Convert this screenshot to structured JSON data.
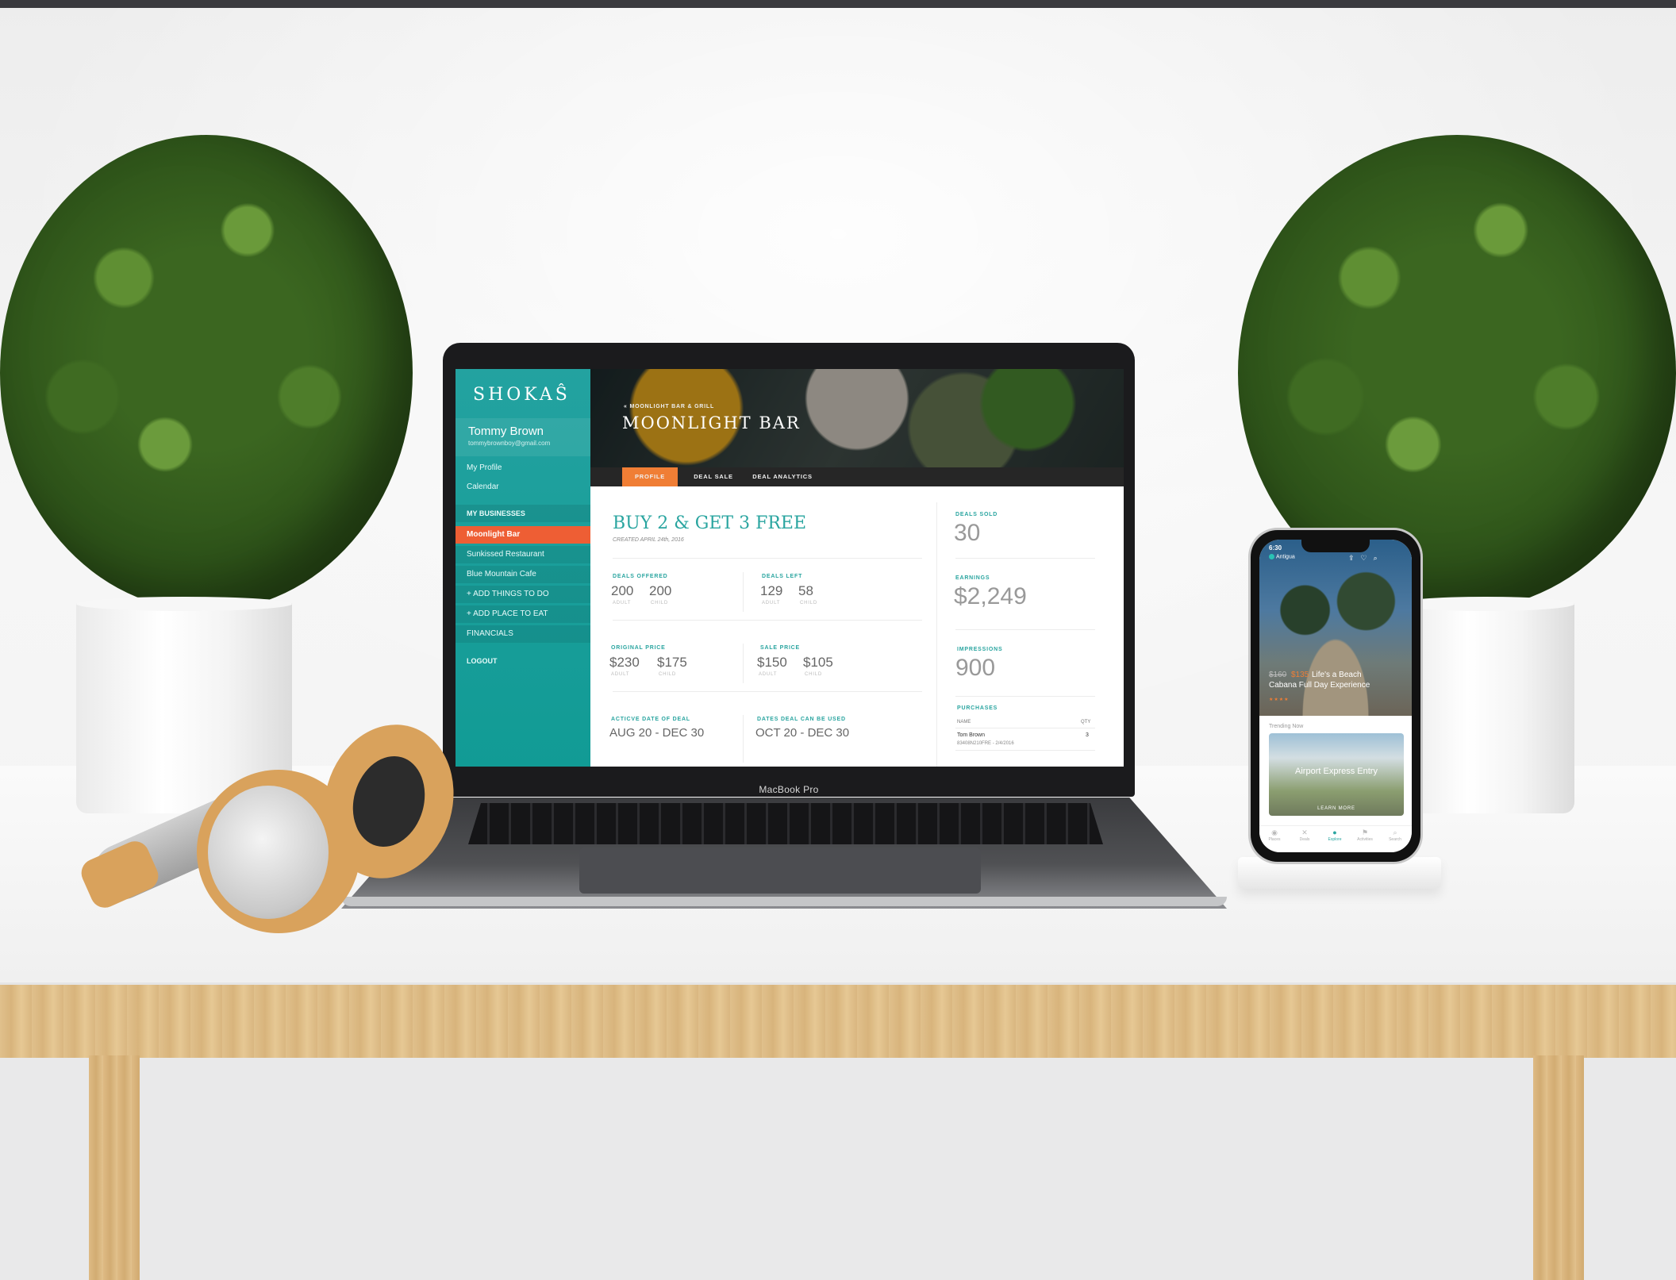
{
  "app": {
    "logo": "SHOKAŜ",
    "user": {
      "name": "Tommy Brown",
      "email": "tommybrownboy@gmail.com"
    },
    "nav": {
      "my_profile": "My Profile",
      "calendar": "Calendar",
      "my_businesses": "MY BUSINESSES",
      "businesses": [
        "Moonlight Bar",
        "Sunkissed Restaurant",
        "Blue Mountain Cafe"
      ],
      "add_things": "+ ADD THINGS TO DO",
      "add_place": "+ ADD PLACE TO EAT",
      "financials": "FINANCIALS",
      "logout": "LOGOUT"
    },
    "hero": {
      "breadcrumb": "« MOONLIGHT BAR & GRILL",
      "title": "MOONLIGHT BAR"
    },
    "tabs": [
      "PROFILE",
      "DEAL SALE",
      "DEAL ANALYTICS"
    ],
    "deal": {
      "title": "BUY 2 & GET 3 FREE",
      "created": "CREATED APRIL 24th, 2016",
      "deals_offered": {
        "label": "DEALS OFFERED",
        "adult": "200",
        "child": "200"
      },
      "deals_left": {
        "label": "DEALS LEFT",
        "adult": "129",
        "child": "58"
      },
      "original_price": {
        "label": "ORIGINAL PRICE",
        "adult": "$230",
        "child": "$175"
      },
      "sale_price": {
        "label": "SALE PRICE",
        "adult": "$150",
        "child": "$105"
      },
      "active_date": {
        "label": "ACTICVE DATE OF DEAL",
        "value": "AUG 20 - DEC 30"
      },
      "dates_used": {
        "label": "DATES DEAL CAN BE USED",
        "value": "OCT 20 - DEC 30"
      },
      "adult_label": "ADULT",
      "child_label": "CHILD"
    },
    "stats": {
      "deals_sold": {
        "label": "DEALS SOLD",
        "value": "30"
      },
      "earnings": {
        "label": "EARNINGS",
        "value": "$2,249"
      },
      "impressions": {
        "label": "IMPRESSIONS",
        "value": "900"
      },
      "purchases": {
        "label": "PURCHASES",
        "col_name": "NAME",
        "col_qty": "QTY",
        "rows": [
          {
            "name": "Tom Brown",
            "code": "83408N210FRE - 2/4/2016",
            "qty": "3"
          }
        ]
      }
    }
  },
  "laptop": {
    "label": "MacBook Pro"
  },
  "phone": {
    "time": "6:30",
    "location": "Antigua",
    "deal_old_price": "$160",
    "deal_new_price": "$135",
    "deal_title_1": "Life's a Beach",
    "deal_title_2": "Cabana Full Day Experience",
    "trending": "Trending Now",
    "card_title": "Airport Express Entry",
    "card_link": "LEARN MORE",
    "nav": [
      "Places",
      "Deals",
      "Explore",
      "Activities",
      "Search"
    ]
  },
  "colors": {
    "teal": "#1fa09c",
    "orange": "#ee5e34",
    "tab_orange": "#f07e35"
  }
}
